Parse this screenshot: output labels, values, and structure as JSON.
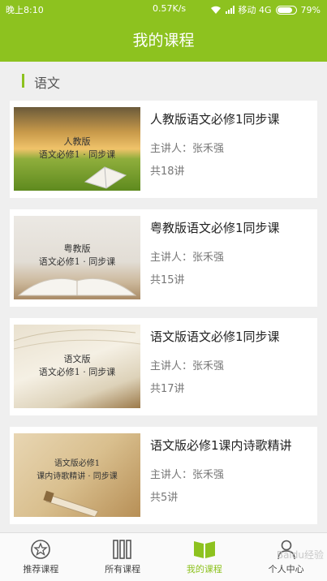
{
  "status_bar": {
    "time": "晚上8:10",
    "speed": "0.57K/s",
    "carrier": "移动 4G",
    "battery": "79%"
  },
  "header": {
    "title": "我的课程"
  },
  "section": {
    "label": "语文"
  },
  "courses": [
    {
      "title": "人教版语文必修1同步课",
      "teacher": "主讲人：张禾强",
      "count": "共18讲",
      "thumb_line1": "人教版",
      "thumb_line2": "语文必修1 · 同步课"
    },
    {
      "title": "粤教版语文必修1同步课",
      "teacher": "主讲人：张禾强",
      "count": "共15讲",
      "thumb_line1": "粤教版",
      "thumb_line2": "语文必修1 · 同步课"
    },
    {
      "title": "语文版语文必修1同步课",
      "teacher": "主讲人：张禾强",
      "count": "共17讲",
      "thumb_line1": "语文版",
      "thumb_line2": "语文必修1 · 同步课"
    },
    {
      "title": "语文版必修1课内诗歌精讲",
      "teacher": "主讲人：张禾强",
      "count": "共5讲",
      "thumb_line1": "语文版必修1",
      "thumb_line2": "课内诗歌精讲 · 同步课"
    }
  ],
  "tabs": [
    {
      "label": "推荐课程",
      "icon": "star-circle-icon"
    },
    {
      "label": "所有课程",
      "icon": "books-icon"
    },
    {
      "label": "我的课程",
      "icon": "open-book-icon",
      "active": true
    },
    {
      "label": "个人中心",
      "icon": "person-icon"
    }
  ],
  "watermark": "Baidu经验",
  "colors": {
    "accent": "#8dc21f",
    "background": "#efefef"
  }
}
